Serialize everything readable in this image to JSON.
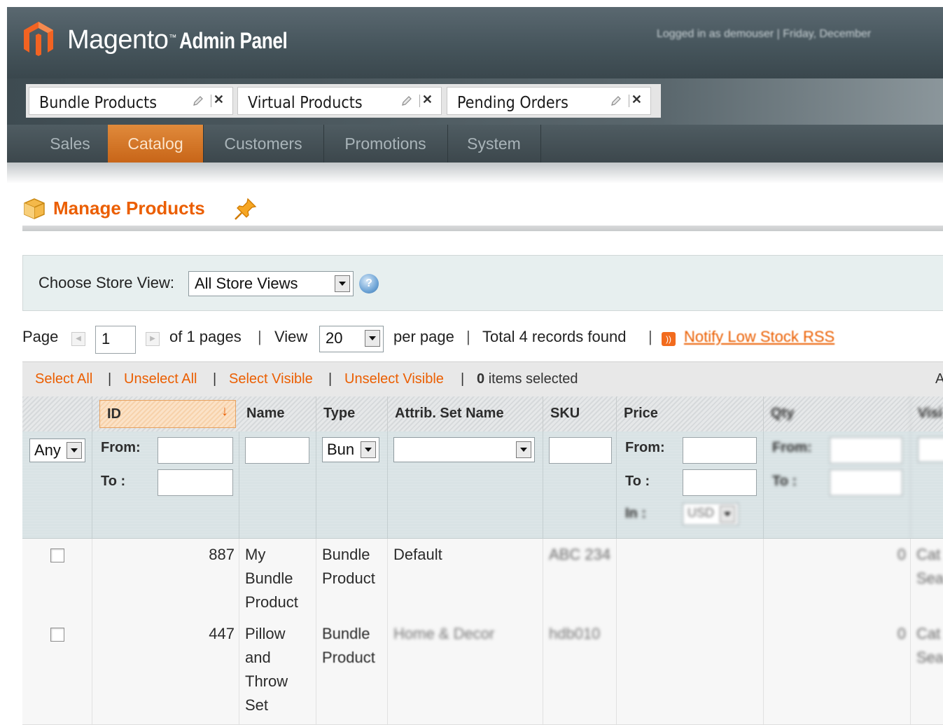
{
  "header": {
    "logo_text": "Magento",
    "logo_tm": "™",
    "logo_sub": "Admin Panel",
    "login_info": "Logged in as demouser  |  Friday, December"
  },
  "bookmark_tabs": [
    {
      "label": "Bundle Products"
    },
    {
      "label": "Virtual Products"
    },
    {
      "label": "Pending Orders"
    }
  ],
  "nav": {
    "items": [
      {
        "label": "Sales"
      },
      {
        "label": "Catalog",
        "active": true
      },
      {
        "label": "Customers"
      },
      {
        "label": "Promotions"
      },
      {
        "label": "System"
      }
    ]
  },
  "page": {
    "title": "Manage Products"
  },
  "store_view": {
    "label": "Choose Store View:",
    "selected": "All Store Views"
  },
  "pager": {
    "page_label": "Page",
    "page_value": "1",
    "of_pages": "of 1 pages",
    "view_label": "View",
    "per_page_value": "20",
    "per_page_label": "per page",
    "total": "Total 4 records found",
    "rss_link": "Notify Low Stock RSS"
  },
  "massaction": {
    "select_all": "Select All",
    "unselect_all": "Unselect All",
    "select_visible": "Select Visible",
    "unselect_visible": "Unselect Visible",
    "count": "0",
    "selected_label": "items selected",
    "cut_text": "A"
  },
  "grid": {
    "columns": {
      "id": "ID",
      "name": "Name",
      "type": "Type",
      "attrib_set": "Attrib. Set Name",
      "sku": "SKU",
      "price": "Price",
      "qty": "Qty",
      "visibility": "Visi"
    },
    "filters": {
      "massaction_select": "Any",
      "from_label": "From:",
      "to_label": "To :",
      "type_select": "Bun",
      "price_from": "From:",
      "price_to": "To :",
      "price_in": "In :",
      "currency": "USD",
      "qty_from": "From:",
      "qty_to": "To :"
    },
    "rows": [
      {
        "id": "887",
        "name": "My Bundle Product",
        "type": "Bundle Product",
        "attrib_set": "Default",
        "sku": "ABC 234",
        "price": "",
        "qty": "0",
        "visibility": "Cat Sea"
      },
      {
        "id": "447",
        "name": "Pillow and Throw Set",
        "type": "Bundle Product",
        "attrib_set": "Home & Decor",
        "sku": "hdb010",
        "price": "",
        "qty": "0",
        "visibility": "Cat Sea"
      }
    ]
  },
  "colors": {
    "accent": "#eb5e00",
    "nav_active": "#d8772a",
    "header_bg": "#46555c"
  },
  "icons": [
    "magento-logo-icon",
    "edit-pencil-icon",
    "close-icon",
    "product-box-icon",
    "pin-icon",
    "help-icon",
    "rss-icon",
    "sort-desc-arrow-icon",
    "dropdown-arrow-icon"
  ]
}
